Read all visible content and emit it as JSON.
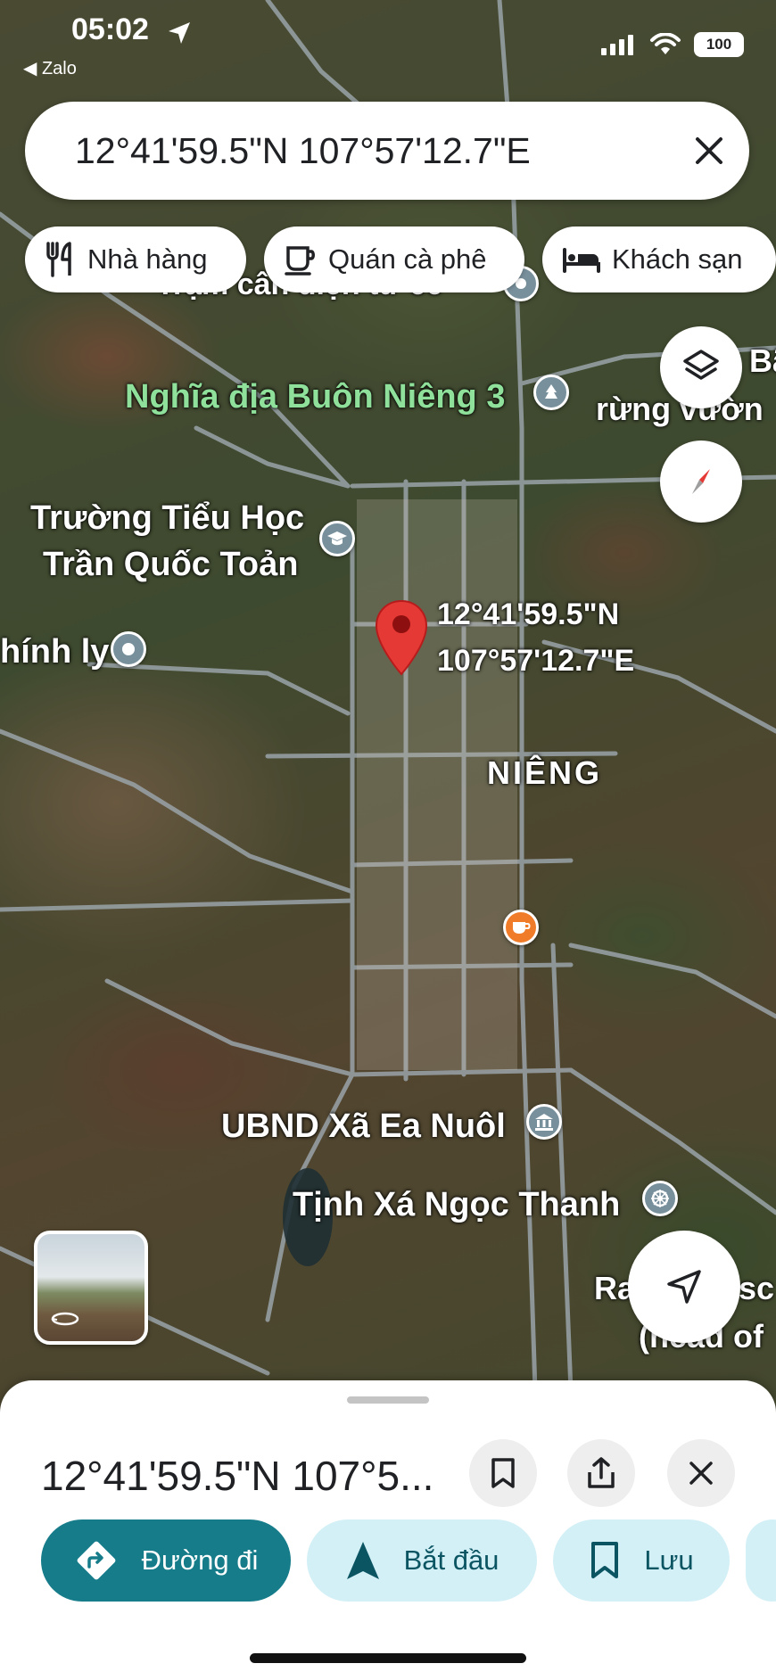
{
  "status_bar": {
    "time": "05:02",
    "back_app": "◀ Zalo",
    "battery": "100"
  },
  "search": {
    "query": "12°41'59.5\"N 107°57'12.7\"E"
  },
  "chips": [
    {
      "label": "Nhà hàng",
      "icon": "restaurant-icon"
    },
    {
      "label": "Quán cà phê",
      "icon": "coffee-icon"
    },
    {
      "label": "Khách sạn",
      "icon": "hotel-icon"
    }
  ],
  "map": {
    "labels": {
      "cut_top": "Trạm cân điện tử 66",
      "cemetery": "Nghĩa địa Buôn Niêng 3",
      "right_top_a": "Bã",
      "right_top_b": "rừng vườn",
      "school_line1": "Trường Tiểu Học",
      "school_line2": "Trần Quốc Toản",
      "left_poi": "hính ly",
      "pin_line1": "12°41'59.5\"N",
      "pin_line2": "107°57'12.7\"E",
      "area": "NIÊNG",
      "ubnd": "UBND Xã Ea Nuôl",
      "temple": "Tịnh Xá Ngọc Thanh",
      "right_bottom_a": "Ra",
      "right_bottom_b": "sc",
      "right_bottom_c": "(head of"
    },
    "colors": {
      "pin": "#e53935",
      "coffee_poi": "#f07c2a",
      "generic_poi": "#78909c"
    }
  },
  "sheet": {
    "title": "12°41'59.5\"N 107°5...",
    "actions": [
      {
        "label": "Đường đi",
        "icon": "directions-icon",
        "style": "primary"
      },
      {
        "label": "Bắt đầu",
        "icon": "navigation-arrow-icon",
        "style": "secondary"
      },
      {
        "label": "Lưu",
        "icon": "bookmark-icon",
        "style": "secondary"
      }
    ]
  }
}
